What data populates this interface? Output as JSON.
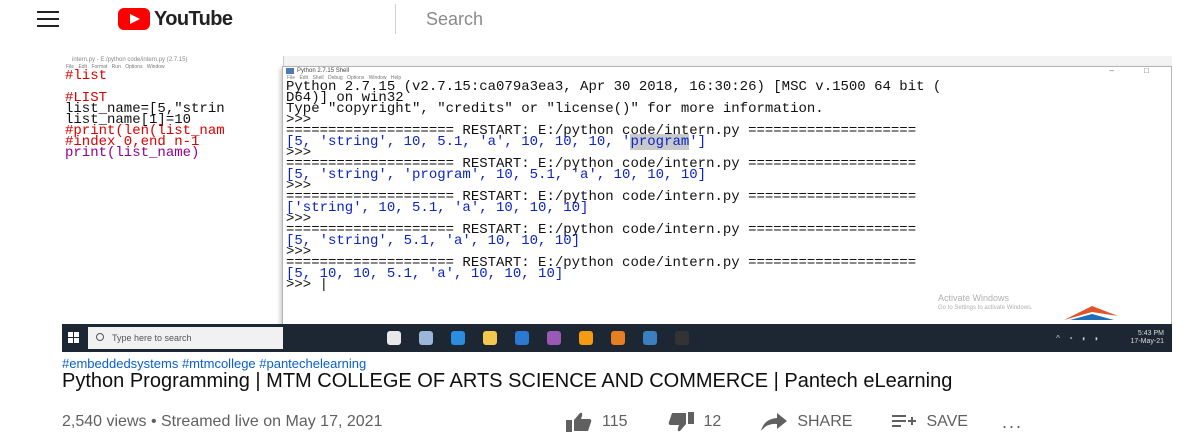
{
  "header": {
    "logo_text": "YouTube",
    "search_placeholder": "Search"
  },
  "video": {
    "editor": {
      "title": "intern.py - E:/python code/intern.py (2.7.15)",
      "menu": "File Edit Format Run Options Window",
      "lines": [
        {
          "text": "#list",
          "kind": "comment"
        },
        {
          "text": "",
          "kind": "normal"
        },
        {
          "text": "#LIST",
          "kind": "comment"
        },
        {
          "text": "list_name=[5,\"strin",
          "kind": "normal"
        },
        {
          "text": "list_name[1]=10",
          "kind": "normal"
        },
        {
          "text": "#print(len(list_nam",
          "kind": "comment"
        },
        {
          "text": "#index 0,end n-1",
          "kind": "comment"
        },
        {
          "text": "print(list_name)",
          "kind": "builtin"
        }
      ]
    },
    "shell": {
      "title": "Python 2.7.15 Shell",
      "menu": "File Edit Shell Debug Options Window Help",
      "window_controls": "– □",
      "banner_1": "Python 2.7.15 (v2.7.15:ca079a3ea3, Apr 30 2018, 16:30:26) [MSC v.1500 64 bit (",
      "banner_2": "D64)] on win32",
      "banner_3": "Type \"copyright\", \"credits\" or \"license()\" for more information.",
      "prompt": ">>> ",
      "restart_line": "==================== RESTART: E:/python code/intern.py ====================",
      "output_1_pre": "[5, 'string', 10, 5.1, 'a', 10, 10, 10, '",
      "output_1_hl": "program",
      "output_1_post": "']",
      "output_2": "[5, 'string', 'program', 10, 5.1, 'a', 10, 10, 10]",
      "output_3": "['string', 10, 5.1, 'a', 10, 10, 10]",
      "output_4": "[5, 'string', 5.1, 'a', 10, 10, 10]",
      "output_5": "[5, 10, 10, 5.1, 'a', 10, 10, 10]",
      "final_prompt": ">>> |"
    },
    "watermark_line1": "Activate Windows",
    "watermark_line2": "Go to Settings to activate Windows.",
    "taskbar": {
      "search_placeholder": "Type here to search",
      "time": "5:43 PM",
      "date": "17-May-21",
      "app_colors": [
        "#e8e8e8",
        "#9ab6d8",
        "#2a8de0",
        "#f2c94c",
        "#2b79d2",
        "#9b59b6",
        "#f39c12",
        "#e67e22",
        "#3a7fc0",
        "#333333"
      ]
    }
  },
  "info": {
    "hashtags": "#embeddedsystems #mtmcollege #pantechelearning",
    "title": "Python Programming | MTM COLLEGE OF ARTS SCIENCE AND COMMERCE | Pantech eLearning",
    "meta": "2,540 views • Streamed live on May 17, 2021",
    "likes": "115",
    "dislikes": "12",
    "share_label": "SHARE",
    "save_label": "SAVE",
    "more_label": "..."
  }
}
